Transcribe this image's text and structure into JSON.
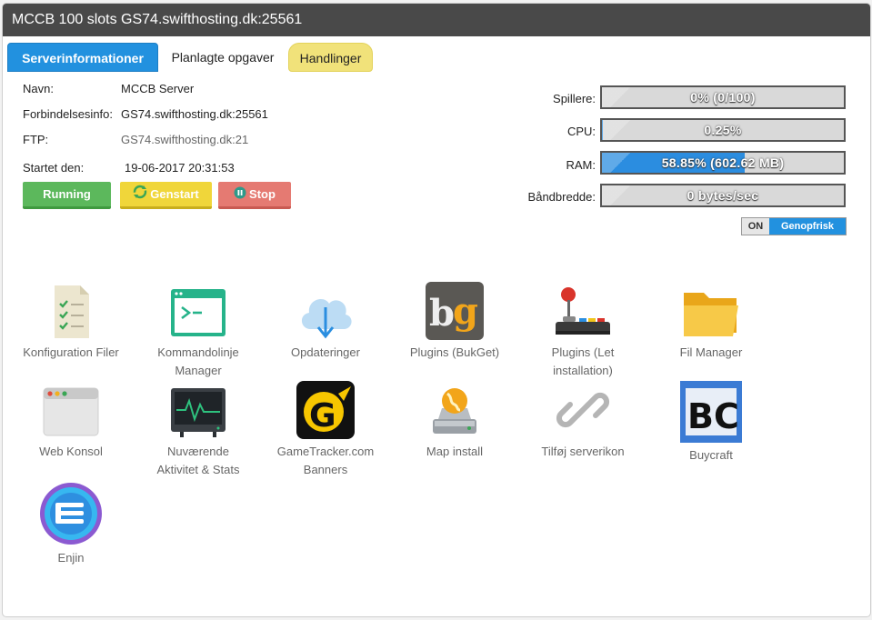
{
  "title": "MCCB 100 slots GS74.swifthosting.dk:25561",
  "tabs": [
    {
      "label": "Serverinformationer"
    },
    {
      "label": "Planlagte opgaver"
    },
    {
      "label": "Handlinger"
    }
  ],
  "info": {
    "navn_label": "Navn:",
    "navn_value": "MCCB Server",
    "forb_label": "Forbindelsesinfo:",
    "forb_value": "GS74.swifthosting.dk:25561",
    "ftp_label": "FTP:",
    "ftp_value": "GS74.swifthosting.dk:21",
    "start_label": "Startet den:",
    "start_value": "19-06-2017 20:31:53"
  },
  "buttons": {
    "running": "Running",
    "restart": "Genstart",
    "stop": "Stop"
  },
  "stats": {
    "players_label": "Spillere:",
    "players_text": "0% (0/100)",
    "players_fraction": 0,
    "cpu_label": "CPU:",
    "cpu_text": "0.25%",
    "cpu_fraction": 0.0025,
    "ram_label": "RAM:",
    "ram_text": "58.85% (602.62 MB)",
    "ram_fraction": 0.5885,
    "bw_label": "Båndbredde:",
    "bw_text": "0 bytes/sec",
    "bw_fraction": 0
  },
  "refresh": {
    "state": "ON",
    "label": "Genopfrisk"
  },
  "apps": [
    {
      "label": "Konfiguration Filer",
      "icon": "config-file-icon"
    },
    {
      "label": "Kommandolinje Manager",
      "icon": "terminal-icon"
    },
    {
      "label": "Opdateringer",
      "icon": "cloud-download-icon"
    },
    {
      "label": "Plugins (BukGet)",
      "icon": "bukget-icon"
    },
    {
      "label": "Plugins (Let installation)",
      "icon": "joystick-icon"
    },
    {
      "label": "Fil Manager",
      "icon": "folder-icon"
    },
    {
      "label": "Web Konsol",
      "icon": "browser-window-icon"
    },
    {
      "label": "Nuværende Aktivitet & Stats",
      "icon": "activity-monitor-icon"
    },
    {
      "label": "GameTracker.com Banners",
      "icon": "gametracker-icon"
    },
    {
      "label": "Map install",
      "icon": "map-install-icon"
    },
    {
      "label": "Tilføj serverikon",
      "icon": "link-icon"
    },
    {
      "label": "Buycraft",
      "icon": "buycraft-icon"
    },
    {
      "label": "Enjin",
      "icon": "enjin-icon"
    }
  ],
  "colors": {
    "titlebar": "#494949",
    "accent": "#2291df",
    "running": "#5cb85c",
    "restart": "#f0d63a",
    "stop": "#e57a72"
  }
}
